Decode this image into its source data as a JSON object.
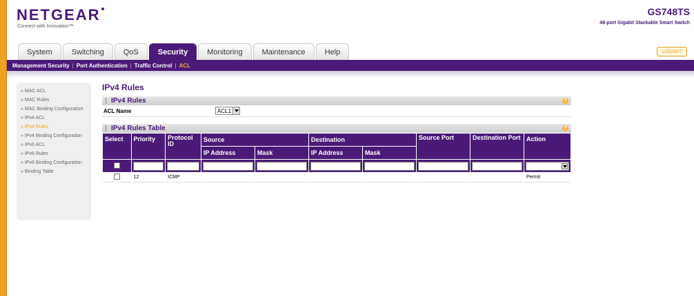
{
  "brand": {
    "logo": "NETGEAR",
    "tagline": "Connect with Innovation™",
    "model": "GS748TS",
    "model_desc": "48-port Gigabit Stackable Smart Switch"
  },
  "tabs": [
    {
      "label": "System"
    },
    {
      "label": "Switching"
    },
    {
      "label": "QoS"
    },
    {
      "label": "Security"
    },
    {
      "label": "Monitoring"
    },
    {
      "label": "Maintenance"
    },
    {
      "label": "Help"
    }
  ],
  "active_tab": "Security",
  "logout_label": "LOGOUT",
  "subnav": [
    {
      "label": "Management Security"
    },
    {
      "label": "Port Authentication"
    },
    {
      "label": "Traffic Control"
    },
    {
      "label": "ACL"
    }
  ],
  "sidebar": [
    {
      "label": "MAC ACL"
    },
    {
      "label": "MAC Rules"
    },
    {
      "label": "MAC Binding Configuration"
    },
    {
      "label": "IPv4 ACL"
    },
    {
      "label": "IPv4 Rules"
    },
    {
      "label": "IPv4 Binding Configuration"
    },
    {
      "label": "IPv6 ACL"
    },
    {
      "label": "IPv6 Rules"
    },
    {
      "label": "IPv6 Binding Configuration"
    },
    {
      "label": "Binding Table"
    }
  ],
  "page_title": "IPv4 Rules",
  "section1": {
    "title": "IPv4 Rules",
    "acl_name_label": "ACL Name",
    "acl_name_value": "ACL1"
  },
  "section2": {
    "title": "IPv4 Rules Table"
  },
  "table": {
    "headers": {
      "select": "Select",
      "priority": "Priority",
      "protocol_id": "Protocol ID",
      "source": "Source",
      "destination": "Destination",
      "source_port": "Source Port",
      "destination_port": "Destination Port",
      "action": "Action",
      "ip_address": "IP Address",
      "mask": "Mask"
    },
    "rows": [
      {
        "priority": "12",
        "protocol": "ICMP",
        "src_ip": "",
        "src_mask": "",
        "dst_ip": "",
        "dst_mask": "",
        "src_port": "",
        "dst_port": "",
        "action": "Permit"
      }
    ]
  },
  "colors": {
    "brand": "#4a1a78",
    "accent": "#f0a020"
  }
}
